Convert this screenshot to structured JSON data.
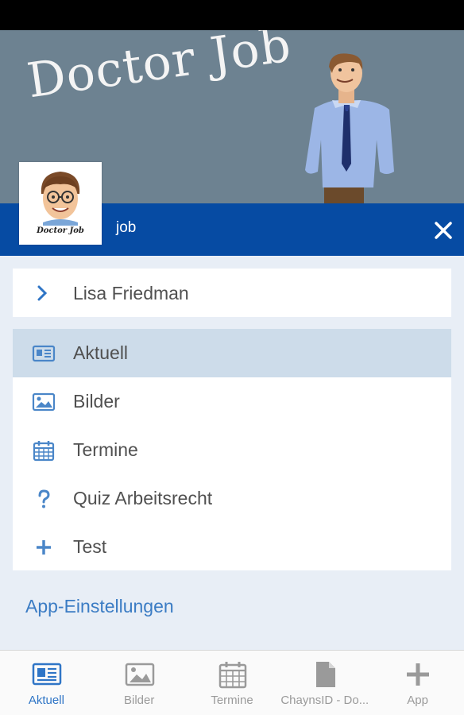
{
  "header": {
    "title": "Doctor Job",
    "avatar_caption": "Doctor Job"
  },
  "title_bar": {
    "text": "job"
  },
  "user": {
    "name": "Lisa Friedman"
  },
  "menu": {
    "items": [
      {
        "label": "Aktuell",
        "icon": "newspaper-icon",
        "active": true
      },
      {
        "label": "Bilder",
        "icon": "image-icon",
        "active": false
      },
      {
        "label": "Termine",
        "icon": "calendar-icon",
        "active": false
      },
      {
        "label": "Quiz Arbeitsrecht",
        "icon": "question-icon",
        "active": false
      },
      {
        "label": "Test",
        "icon": "plus-icon",
        "active": false
      }
    ]
  },
  "settings": {
    "app_settings_label": "App-Einstellungen"
  },
  "tab_bar": {
    "tabs": [
      {
        "label": "Aktuell",
        "icon": "newspaper-icon",
        "active": true
      },
      {
        "label": "Bilder",
        "icon": "image-icon",
        "active": false
      },
      {
        "label": "Termine",
        "icon": "calendar-icon",
        "active": false
      },
      {
        "label": "ChaynsID - Do...",
        "icon": "document-icon",
        "active": false
      },
      {
        "label": "App",
        "icon": "plus-icon",
        "active": false
      }
    ]
  },
  "colors": {
    "header_bg": "#6d8291",
    "title_bar_bg": "#064ba3",
    "accent_blue": "#2f75c6",
    "active_row_bg": "#cddcea",
    "page_bg": "#e8eef6"
  }
}
